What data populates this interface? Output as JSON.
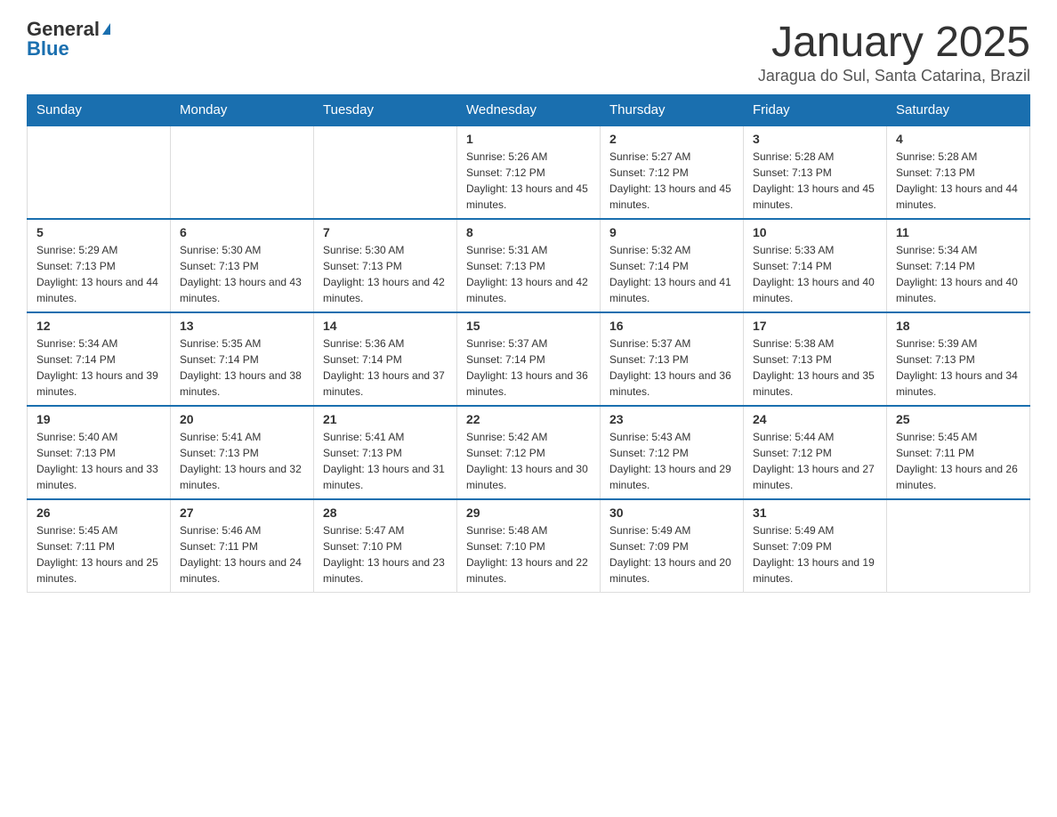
{
  "logo": {
    "text_general": "General",
    "text_blue": "Blue"
  },
  "title": "January 2025",
  "subtitle": "Jaragua do Sul, Santa Catarina, Brazil",
  "days_of_week": [
    "Sunday",
    "Monday",
    "Tuesday",
    "Wednesday",
    "Thursday",
    "Friday",
    "Saturday"
  ],
  "weeks": [
    [
      {
        "day": "",
        "info": ""
      },
      {
        "day": "",
        "info": ""
      },
      {
        "day": "",
        "info": ""
      },
      {
        "day": "1",
        "info": "Sunrise: 5:26 AM\nSunset: 7:12 PM\nDaylight: 13 hours and 45 minutes."
      },
      {
        "day": "2",
        "info": "Sunrise: 5:27 AM\nSunset: 7:12 PM\nDaylight: 13 hours and 45 minutes."
      },
      {
        "day": "3",
        "info": "Sunrise: 5:28 AM\nSunset: 7:13 PM\nDaylight: 13 hours and 45 minutes."
      },
      {
        "day": "4",
        "info": "Sunrise: 5:28 AM\nSunset: 7:13 PM\nDaylight: 13 hours and 44 minutes."
      }
    ],
    [
      {
        "day": "5",
        "info": "Sunrise: 5:29 AM\nSunset: 7:13 PM\nDaylight: 13 hours and 44 minutes."
      },
      {
        "day": "6",
        "info": "Sunrise: 5:30 AM\nSunset: 7:13 PM\nDaylight: 13 hours and 43 minutes."
      },
      {
        "day": "7",
        "info": "Sunrise: 5:30 AM\nSunset: 7:13 PM\nDaylight: 13 hours and 42 minutes."
      },
      {
        "day": "8",
        "info": "Sunrise: 5:31 AM\nSunset: 7:13 PM\nDaylight: 13 hours and 42 minutes."
      },
      {
        "day": "9",
        "info": "Sunrise: 5:32 AM\nSunset: 7:14 PM\nDaylight: 13 hours and 41 minutes."
      },
      {
        "day": "10",
        "info": "Sunrise: 5:33 AM\nSunset: 7:14 PM\nDaylight: 13 hours and 40 minutes."
      },
      {
        "day": "11",
        "info": "Sunrise: 5:34 AM\nSunset: 7:14 PM\nDaylight: 13 hours and 40 minutes."
      }
    ],
    [
      {
        "day": "12",
        "info": "Sunrise: 5:34 AM\nSunset: 7:14 PM\nDaylight: 13 hours and 39 minutes."
      },
      {
        "day": "13",
        "info": "Sunrise: 5:35 AM\nSunset: 7:14 PM\nDaylight: 13 hours and 38 minutes."
      },
      {
        "day": "14",
        "info": "Sunrise: 5:36 AM\nSunset: 7:14 PM\nDaylight: 13 hours and 37 minutes."
      },
      {
        "day": "15",
        "info": "Sunrise: 5:37 AM\nSunset: 7:14 PM\nDaylight: 13 hours and 36 minutes."
      },
      {
        "day": "16",
        "info": "Sunrise: 5:37 AM\nSunset: 7:13 PM\nDaylight: 13 hours and 36 minutes."
      },
      {
        "day": "17",
        "info": "Sunrise: 5:38 AM\nSunset: 7:13 PM\nDaylight: 13 hours and 35 minutes."
      },
      {
        "day": "18",
        "info": "Sunrise: 5:39 AM\nSunset: 7:13 PM\nDaylight: 13 hours and 34 minutes."
      }
    ],
    [
      {
        "day": "19",
        "info": "Sunrise: 5:40 AM\nSunset: 7:13 PM\nDaylight: 13 hours and 33 minutes."
      },
      {
        "day": "20",
        "info": "Sunrise: 5:41 AM\nSunset: 7:13 PM\nDaylight: 13 hours and 32 minutes."
      },
      {
        "day": "21",
        "info": "Sunrise: 5:41 AM\nSunset: 7:13 PM\nDaylight: 13 hours and 31 minutes."
      },
      {
        "day": "22",
        "info": "Sunrise: 5:42 AM\nSunset: 7:12 PM\nDaylight: 13 hours and 30 minutes."
      },
      {
        "day": "23",
        "info": "Sunrise: 5:43 AM\nSunset: 7:12 PM\nDaylight: 13 hours and 29 minutes."
      },
      {
        "day": "24",
        "info": "Sunrise: 5:44 AM\nSunset: 7:12 PM\nDaylight: 13 hours and 27 minutes."
      },
      {
        "day": "25",
        "info": "Sunrise: 5:45 AM\nSunset: 7:11 PM\nDaylight: 13 hours and 26 minutes."
      }
    ],
    [
      {
        "day": "26",
        "info": "Sunrise: 5:45 AM\nSunset: 7:11 PM\nDaylight: 13 hours and 25 minutes."
      },
      {
        "day": "27",
        "info": "Sunrise: 5:46 AM\nSunset: 7:11 PM\nDaylight: 13 hours and 24 minutes."
      },
      {
        "day": "28",
        "info": "Sunrise: 5:47 AM\nSunset: 7:10 PM\nDaylight: 13 hours and 23 minutes."
      },
      {
        "day": "29",
        "info": "Sunrise: 5:48 AM\nSunset: 7:10 PM\nDaylight: 13 hours and 22 minutes."
      },
      {
        "day": "30",
        "info": "Sunrise: 5:49 AM\nSunset: 7:09 PM\nDaylight: 13 hours and 20 minutes."
      },
      {
        "day": "31",
        "info": "Sunrise: 5:49 AM\nSunset: 7:09 PM\nDaylight: 13 hours and 19 minutes."
      },
      {
        "day": "",
        "info": ""
      }
    ]
  ]
}
